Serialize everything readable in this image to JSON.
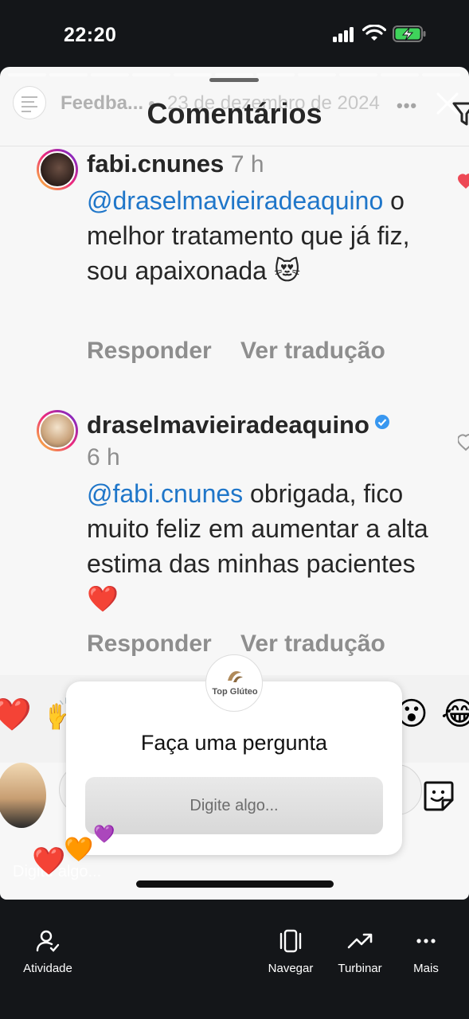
{
  "status_bar": {
    "time": "22:20",
    "icons": [
      "signal-icon",
      "wifi-icon",
      "battery-charging-icon"
    ]
  },
  "story": {
    "user": "Feedba...",
    "date": "23 de dezembro de 2024",
    "icons": [
      "more-icon",
      "close-icon"
    ]
  },
  "sheet": {
    "title": "Comentários",
    "icons": [
      "filter-icon"
    ]
  },
  "comments": [
    {
      "user": "fabi.cnunes",
      "time": "7 h",
      "mention": "@draselmavieiradeaquino",
      "text": " o melhor tratamento que já fiz, sou apaixonada 😻",
      "reply": "Responder",
      "translate": "Ver tradução"
    },
    {
      "user": "draselmavieiradeaquino",
      "time": "6 h",
      "verified": true,
      "mention": "@fabi.cnunes",
      "text": " obrigada, fico muito feliz em aumentar a alta estima das minhas pacientes❤️",
      "reply": "Responder",
      "translate": "Ver tradução"
    }
  ],
  "reactions": [
    "❤️",
    "🙌",
    "😮",
    "😂"
  ],
  "question_sticker": {
    "brand": "Top Glúteo",
    "title": "Faça uma pergunta",
    "placeholder": "Digite algo..."
  },
  "composer": {
    "reply_hint": "Digite algo..."
  },
  "floating_hearts": [
    "❤️",
    "🧡",
    "💜"
  ],
  "bottom_nav": [
    {
      "label": "Atividade",
      "icon": "activity-icon"
    },
    {
      "label": "Navegar",
      "icon": "browse-icon"
    },
    {
      "label": "Turbinar",
      "icon": "boost-icon"
    },
    {
      "label": "Mais",
      "icon": "more-icon"
    }
  ],
  "colors": {
    "mention": "#1f76c9",
    "verified": "#3897f0",
    "background": "#141619",
    "sheet": "#f7f7f7"
  }
}
